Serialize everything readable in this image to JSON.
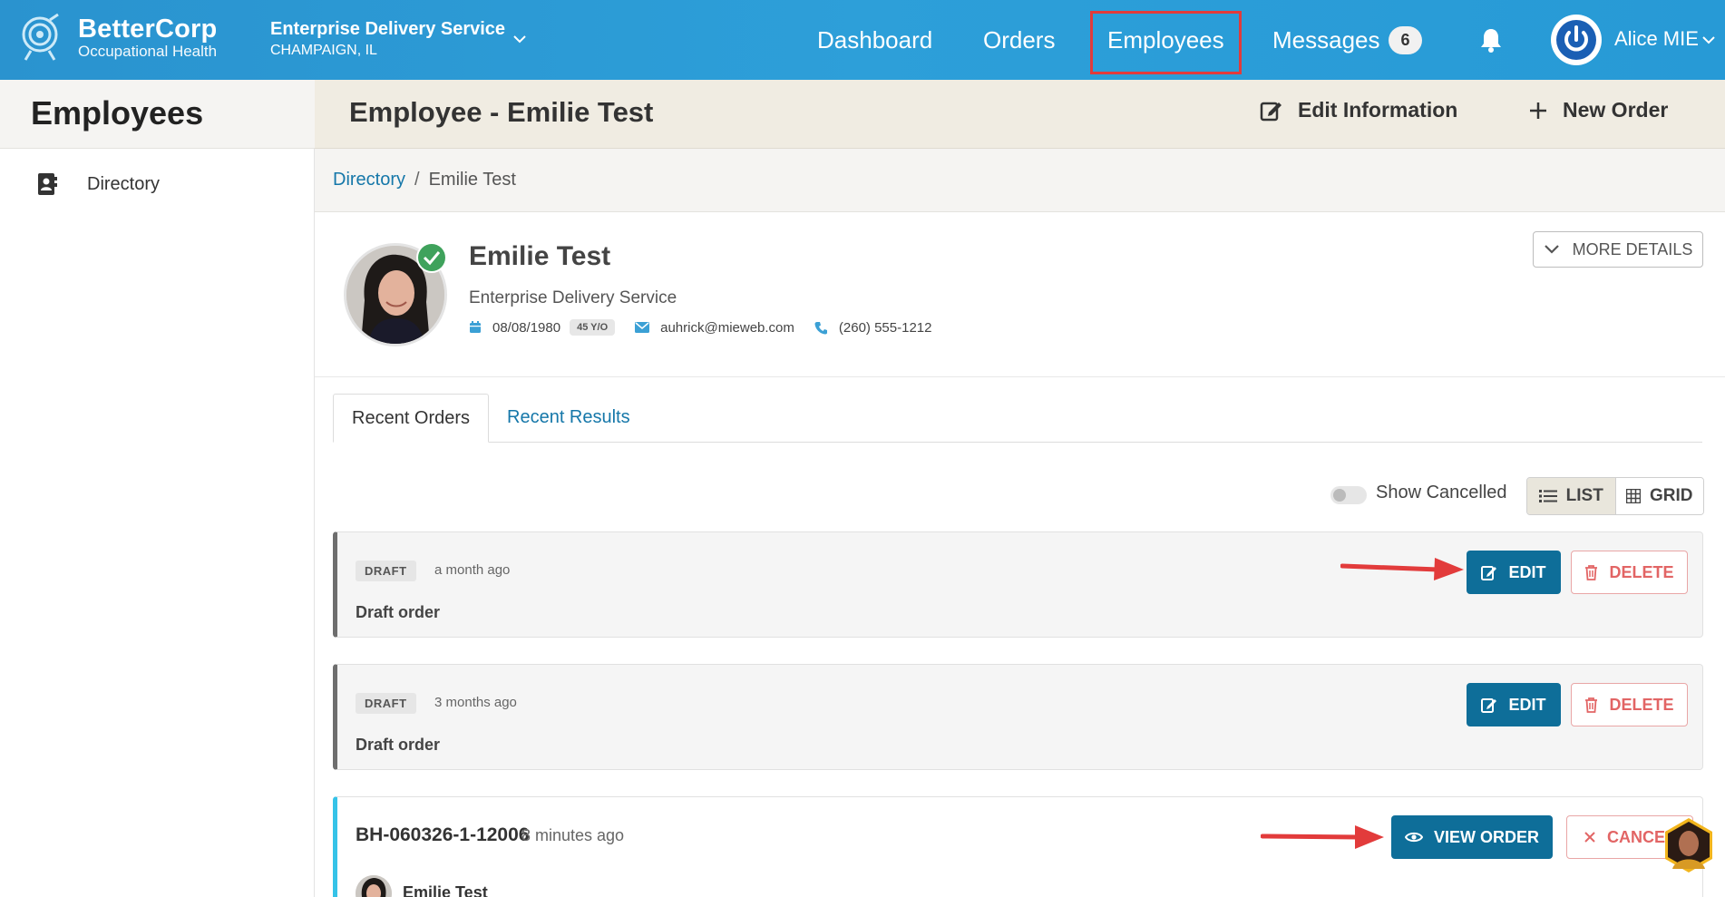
{
  "brand": {
    "name": "BetterCorp",
    "subtitle": "Occupational Health"
  },
  "org": {
    "name": "Enterprise Delivery Service",
    "location": "CHAMPAIGN, IL"
  },
  "nav": {
    "dashboard": "Dashboard",
    "orders": "Orders",
    "employees": "Employees",
    "messages": "Messages",
    "messages_count": "6"
  },
  "user": {
    "name": "Alice MIE"
  },
  "sidebar": {
    "title": "Employees",
    "items": [
      {
        "label": "Directory",
        "icon": "contact-book-icon"
      }
    ]
  },
  "header": {
    "title": "Employee - Emilie Test",
    "edit_label": "Edit Information",
    "new_order_label": "New Order"
  },
  "breadcrumb": {
    "link": "Directory",
    "separator": "/",
    "current": "Emilie Test"
  },
  "profile": {
    "name": "Emilie Test",
    "company": "Enterprise Delivery Service",
    "dob": "08/08/1980",
    "age": "45 Y/O",
    "email": "auhrick@mieweb.com",
    "phone": "(260) 555-1212",
    "more_details": "MORE DETAILS"
  },
  "tabs": [
    {
      "label": "Recent Orders",
      "active": true
    },
    {
      "label": "Recent Results",
      "active": false
    }
  ],
  "toolbar": {
    "show_cancelled": "Show Cancelled",
    "list": "LIST",
    "grid": "GRID"
  },
  "orders": [
    {
      "status": "DRAFT",
      "time": "a month ago",
      "desc": "Draft order",
      "edit": "EDIT",
      "delete": "DELETE"
    },
    {
      "status": "DRAFT",
      "time": "3 months ago",
      "desc": "Draft order",
      "edit": "EDIT",
      "delete": "DELETE"
    },
    {
      "id": "BH-060326-1-12006",
      "time": "8 minutes ago",
      "view": "VIEW ORDER",
      "cancel": "CANCEL",
      "employee": "Emilie Test"
    }
  ],
  "colors": {
    "topbar": "#2d9fd9",
    "primary_button": "#0e6e99",
    "danger": "#e26565",
    "link": "#1577a9",
    "highlight": "#e23b3b"
  }
}
